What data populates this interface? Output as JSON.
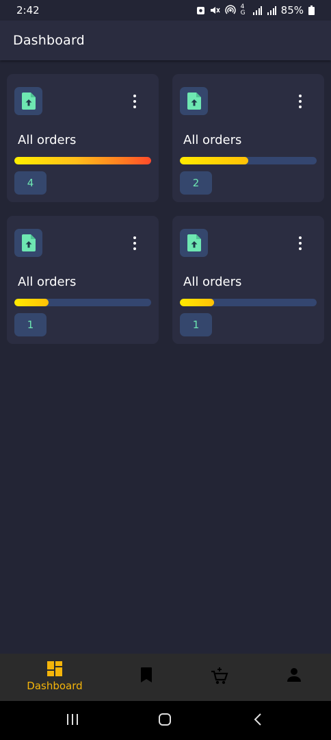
{
  "status_bar": {
    "time": "2:42",
    "battery": "85%",
    "network": "4G",
    "icons": [
      "lock-app-icon",
      "mute-icon",
      "hotspot-icon",
      "4g-icon",
      "signal-icon",
      "signal-icon",
      "battery-icon"
    ]
  },
  "app_bar": {
    "title": "Dashboard"
  },
  "cards": [
    {
      "label": "All orders",
      "count": "4",
      "progress": 1.0,
      "icon": "file-upload-icon"
    },
    {
      "label": "All orders",
      "count": "2",
      "progress": 0.5,
      "icon": "file-upload-icon"
    },
    {
      "label": "All orders",
      "count": "1",
      "progress": 0.25,
      "icon": "file-upload-icon"
    },
    {
      "label": "All orders",
      "count": "1",
      "progress": 0.25,
      "icon": "file-upload-icon"
    }
  ],
  "bottom_nav": {
    "active": "dashboard",
    "items": [
      {
        "id": "dashboard",
        "label": "Dashboard",
        "icon": "dashboard-icon"
      },
      {
        "id": "bookmarks",
        "icon": "bookmark-icon"
      },
      {
        "id": "cart",
        "icon": "cart-add-icon"
      },
      {
        "id": "profile",
        "icon": "person-icon"
      }
    ]
  },
  "colors": {
    "background": "#232535",
    "card": "#2b2d41",
    "accent": "#f5b50a",
    "icon_green": "#6ee7b2",
    "chip": "#35476d"
  }
}
